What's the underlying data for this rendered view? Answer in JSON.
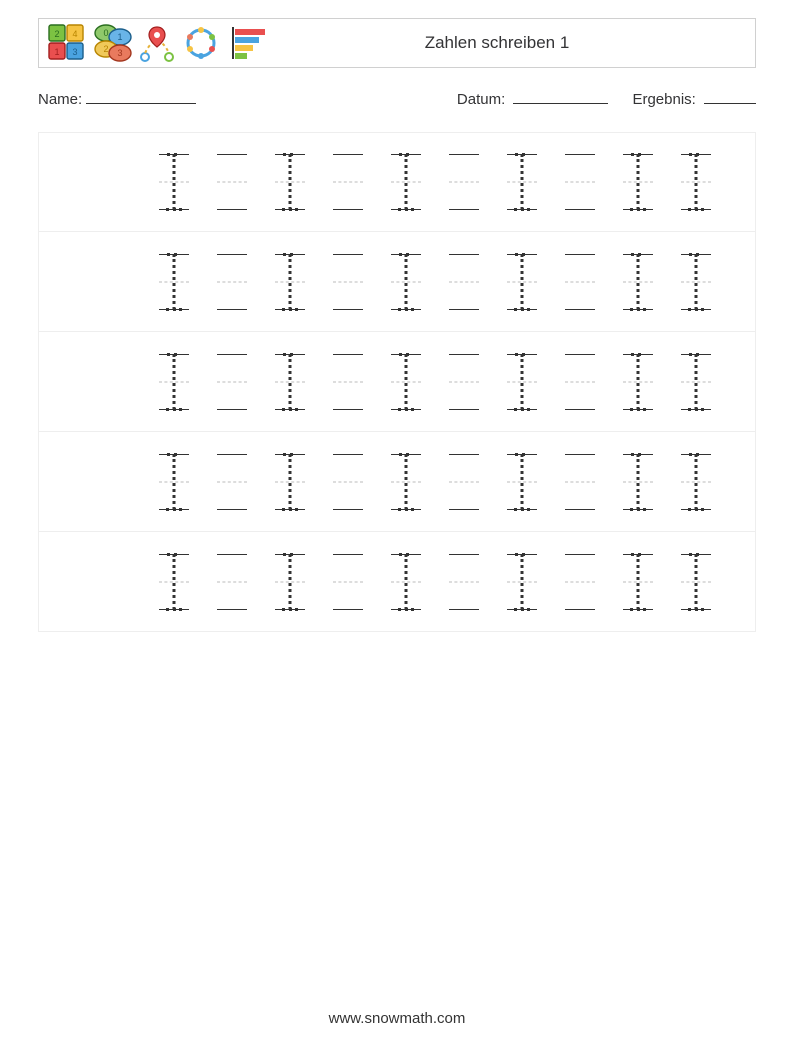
{
  "header": {
    "title": "Zahlen schreiben 1"
  },
  "fields": {
    "name_label": "Name:",
    "date_label": "Datum:",
    "result_label": "Ergebnis:"
  },
  "worksheet": {
    "digit": "1",
    "rows": 5,
    "cells_per_row": 10,
    "pattern": [
      "glyph",
      "blank",
      "glyph",
      "blank",
      "glyph",
      "blank",
      "glyph",
      "blank",
      "glyph",
      "blank"
    ],
    "pattern_last_has_glyph": true
  },
  "footer": {
    "url": "www.snowmath.com"
  }
}
